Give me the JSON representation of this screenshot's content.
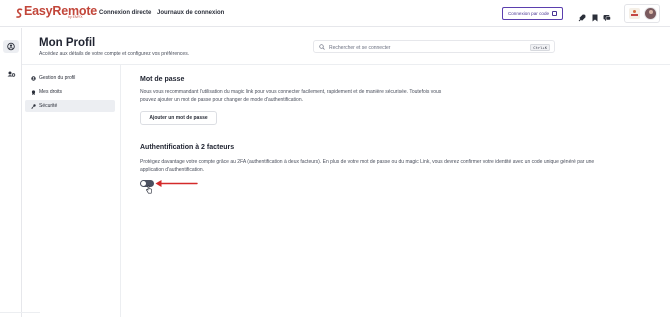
{
  "app": {
    "logo_text": "EasyRemote",
    "logo_sub": "by EMYX",
    "brand_color": "#c2463a",
    "accent_color": "#5b3fae"
  },
  "nav": {
    "links": [
      "Connexion directe",
      "Journaux de connexion"
    ],
    "code_button": "Connexion par code",
    "icons": [
      "rocket-icon",
      "bookmark-icon",
      "chat-icon"
    ]
  },
  "header": {
    "title": "Mon Profil",
    "subtitle": "Accédez aux détails de votre compte et configurez vos préférences."
  },
  "search": {
    "placeholder": "Rechercher et se connecter",
    "shortcut": "Ctrl+K"
  },
  "sidemenu": {
    "items": [
      {
        "label": "Gestion du profil",
        "icon": "user-icon",
        "active": false
      },
      {
        "label": "Mes droits",
        "icon": "badge-icon",
        "active": false
      },
      {
        "label": "Sécurité",
        "icon": "key-icon",
        "active": true
      }
    ]
  },
  "password_section": {
    "title": "Mot de passe",
    "text_line1": "Nous vous recommandant l'utilisation du magic link pour vous connecter facilement, rapidement et de manière sécurisée. Toutefois vous",
    "text_line2": "pouvez ajouter un mot de passe pour changer de mode d'authentification.",
    "button": "Ajouter un mot de passe"
  },
  "twofa_section": {
    "title": "Authentification à 2 facteurs",
    "text_line1": "Protégez davantage votre compte grâce au 2FA (authentification à deux facteurs). En plus de votre mot de passe ou du magic Link, vous devrez confirmer votre identité avec un code unique généré par une",
    "text_line2": "application d'authentification.",
    "toggle_enabled": false
  },
  "annotation": {
    "arrow_color": "#d42a2a"
  }
}
